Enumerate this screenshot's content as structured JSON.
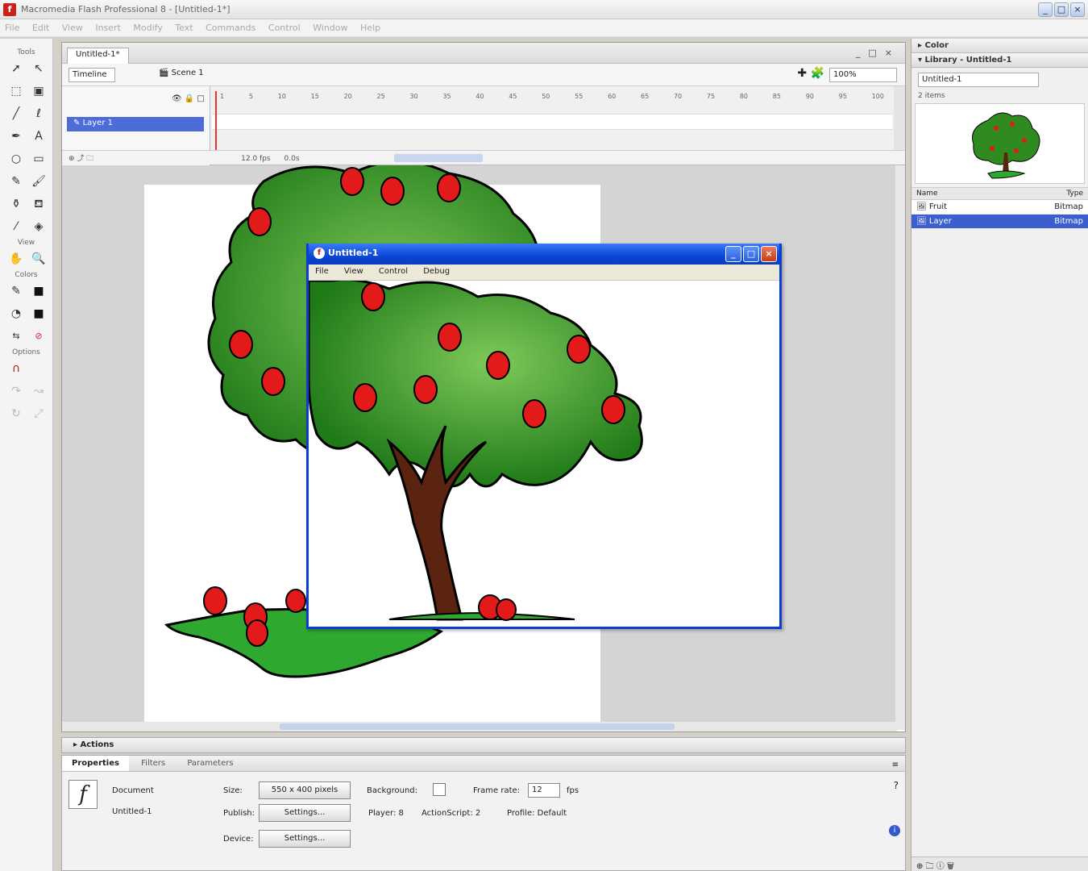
{
  "window": {
    "title": "Macromedia Flash Professional 8 - [Untitled-1*]"
  },
  "menubar": [
    "File",
    "Edit",
    "View",
    "Insert",
    "Modify",
    "Text",
    "Commands",
    "Control",
    "Window",
    "Help"
  ],
  "tools": {
    "section_tools": "Tools",
    "section_view": "View",
    "section_colors": "Colors",
    "section_options": "Options"
  },
  "document": {
    "tab": "Untitled-1*",
    "timeline_button": "Timeline",
    "scene": "Scene 1",
    "zoom": "100%",
    "layer_name": "Layer 1",
    "ruler": [
      "1",
      "5",
      "10",
      "15",
      "20",
      "25",
      "30",
      "35",
      "40",
      "45",
      "50",
      "55",
      "60",
      "65",
      "70",
      "75",
      "80",
      "85",
      "90",
      "95",
      "100"
    ],
    "fps": "12.0 fps",
    "time": "0.0s"
  },
  "right": {
    "color_title": "Color",
    "library_title": "Library - Untitled-1",
    "library_select": "Untitled-1",
    "items_count": "2 items",
    "col_name": "Name",
    "col_type": "Type",
    "items": [
      {
        "name": "Fruit",
        "type": "Bitmap"
      },
      {
        "name": "Layer",
        "type": "Bitmap"
      }
    ]
  },
  "actions": {
    "title": "Actions"
  },
  "properties": {
    "tabs": [
      "Properties",
      "Filters",
      "Parameters"
    ],
    "doc_label": "Document",
    "doc_name": "Untitled-1",
    "size_label": "Size:",
    "size_value": "550 x 400 pixels",
    "publish_label": "Publish:",
    "publish_value": "Settings...",
    "device_label": "Device:",
    "device_value": "Settings...",
    "bg_label": "Background:",
    "fps_label": "Frame rate:",
    "fps_value": "12",
    "fps_unit": "fps",
    "player_label": "Player: 8",
    "actionscript_label": "ActionScript: 2",
    "profile_label": "Profile: Default"
  },
  "player": {
    "title": "Untitled-1",
    "menu": [
      "File",
      "View",
      "Control",
      "Debug"
    ]
  },
  "colors": {
    "leaf": "#2f8a1f",
    "leaf_light": "#58b13a",
    "apple": "#e31a1a",
    "trunk": "#5a2410",
    "grass": "#2fa830",
    "selection_blue": "#3b5fd0",
    "xp_title": "#0a47d6"
  }
}
